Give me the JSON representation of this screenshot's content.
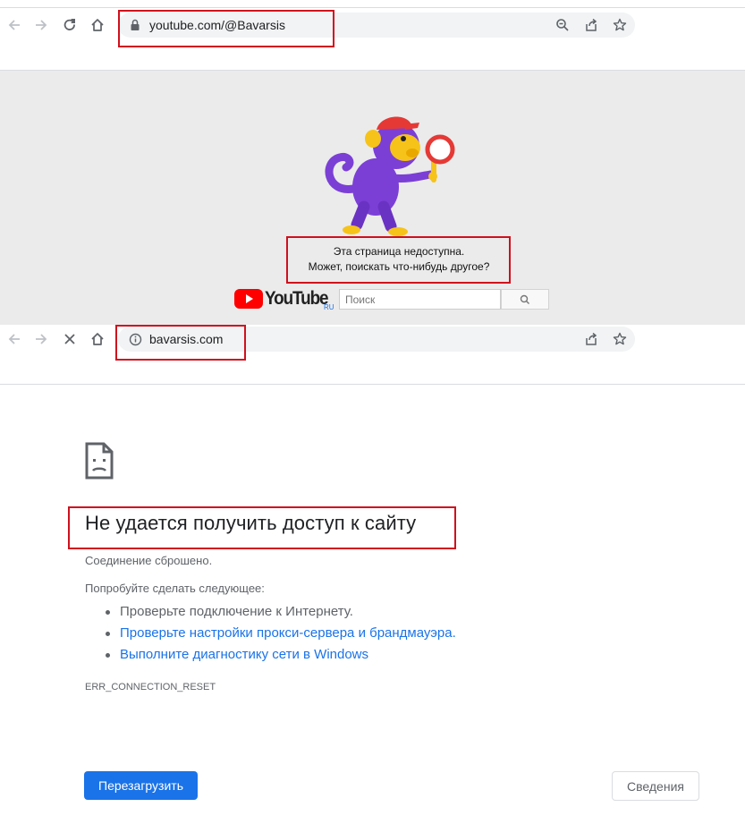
{
  "browser1": {
    "url": "youtube.com/@Bavarsis"
  },
  "youtube_page": {
    "message_line1": "Эта страница недоступна.",
    "message_line2": "Может, поискать что-нибудь другое?",
    "logo_text": "YouTube",
    "logo_region": "RU",
    "search_placeholder": "Поиск",
    "brand_color": "#ff0000"
  },
  "browser2": {
    "url": "bavarsis.com"
  },
  "error_page": {
    "title": "Не удается получить доступ к сайту",
    "subtitle": "Соединение сброшено.",
    "try_label": "Попробуйте сделать следующее:",
    "suggestions": [
      "Проверьте подключение к Интернету.",
      "Проверьте настройки прокси-сервера и брандмауэра.",
      "Выполните диагностику сети в Windows"
    ],
    "error_code": "ERR_CONNECTION_RESET",
    "reload_label": "Перезагрузить",
    "details_label": "Сведения",
    "link_color": "#1a73e8",
    "highlight_color": "#d0101c"
  },
  "icons": [
    "back-arrow-icon",
    "forward-arrow-icon",
    "reload-icon",
    "stop-icon",
    "home-icon",
    "lock-icon",
    "info-icon",
    "zoom-icon",
    "share-icon",
    "star-icon",
    "sad-page-icon",
    "search-icon"
  ]
}
